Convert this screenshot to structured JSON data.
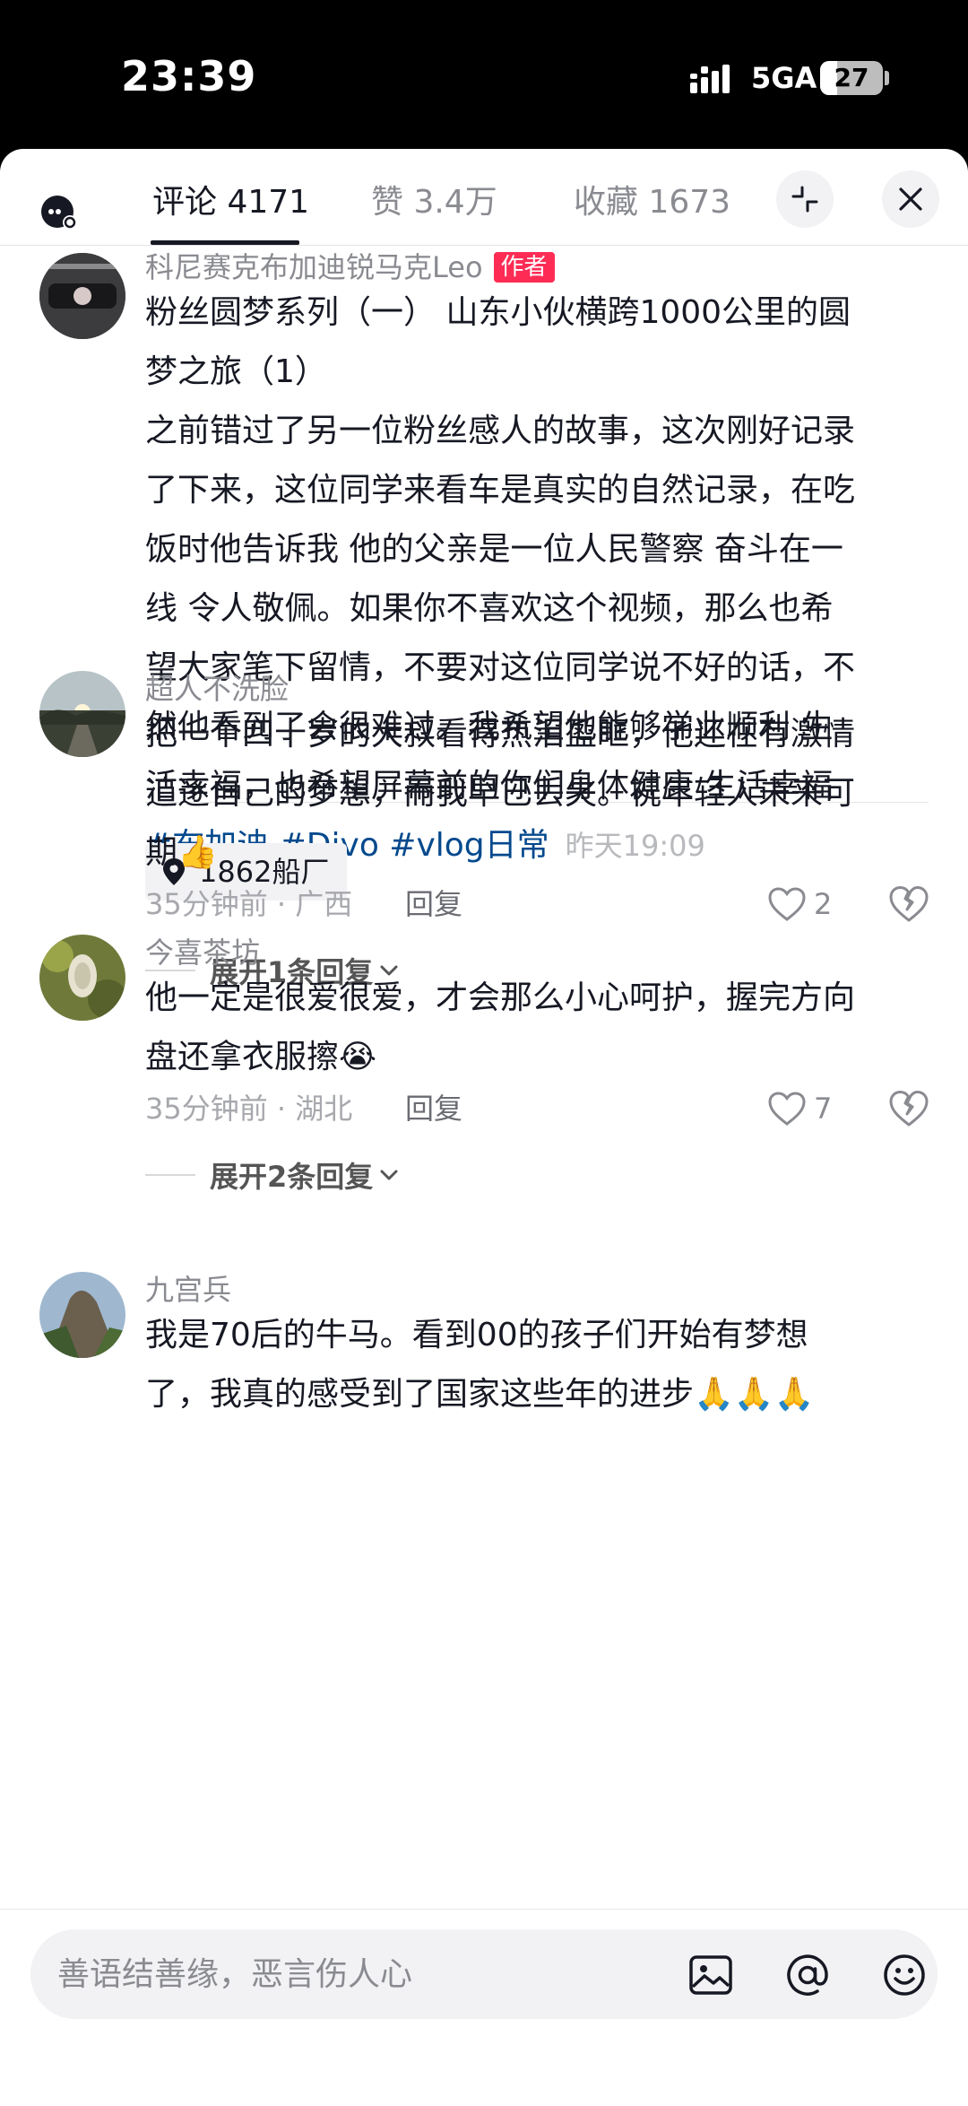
{
  "status_bar": {
    "time": "23:39",
    "network": "5GA",
    "battery": "27",
    "battery_level": 0.27
  },
  "tabs": [
    {
      "label": "评论 4171",
      "active": true
    },
    {
      "label": "赞 3.4万",
      "active": false
    },
    {
      "label": "收藏 1673",
      "active": false
    }
  ],
  "author_post": {
    "username": "科尼赛克布加迪锐马克Leo",
    "badge": "作者",
    "lines": [
      "粉丝圆梦系列（一） 山东小伙横跨1000公里的圆",
      "梦之旅（1）",
      "之前错过了另一位粉丝感人的故事，这次刚好记录",
      "了下来，这位同学来看车是真实的自然记录，在吃",
      "饭时他告诉我 他的父亲是一位人民警察 奋斗在一",
      "线 令人敬佩。如果你不喜欢这个视频，那么也希",
      "望大家笔下留情，不要对这位同学说不好的话，不",
      "然他看到了会很难过。我希望他能够学业顺利 生",
      "活幸福，也希望屏幕前的你们身体健康 生活幸福"
    ],
    "hashtags": [
      "#布加迪",
      "#Divo",
      "#vlog日常"
    ],
    "time": "昨天19:09",
    "location": "1862船厂"
  },
  "comments": [
    {
      "username": "超人不洗脸",
      "lines": [
        "把一个四十岁的大叔看得热泪盈眶，他还在有激情",
        "追逐自己的梦想，而我早已丢失。祝年轻人未来可",
        "期👍"
      ],
      "meta": "35分钟前 · 广西",
      "reply": "回复",
      "likes": "2",
      "expand": "展开1条回复"
    },
    {
      "username": "今喜茶坊",
      "lines": [
        "他一定是很爱很爱，才会那么小心呵护，握完方向",
        "盘还拿衣服擦😭"
      ],
      "meta": "35分钟前 · 湖北",
      "reply": "回复",
      "likes": "7",
      "expand": "展开2条回复"
    },
    {
      "username": "九宫兵",
      "lines": [
        "我是70后的牛马。看到00的孩子们开始有梦想",
        "了，我真的感受到了国家这些年的进步🙏🙏🙏"
      ]
    }
  ],
  "input": {
    "placeholder": "善语结善缘，恶言伤人心"
  },
  "icons": [
    "robot-icon",
    "collapse-icon",
    "close-icon",
    "location-pin-icon",
    "heart-icon",
    "broken-heart-icon",
    "chevron-down-icon",
    "image-icon",
    "at-icon",
    "emoji-icon"
  ]
}
